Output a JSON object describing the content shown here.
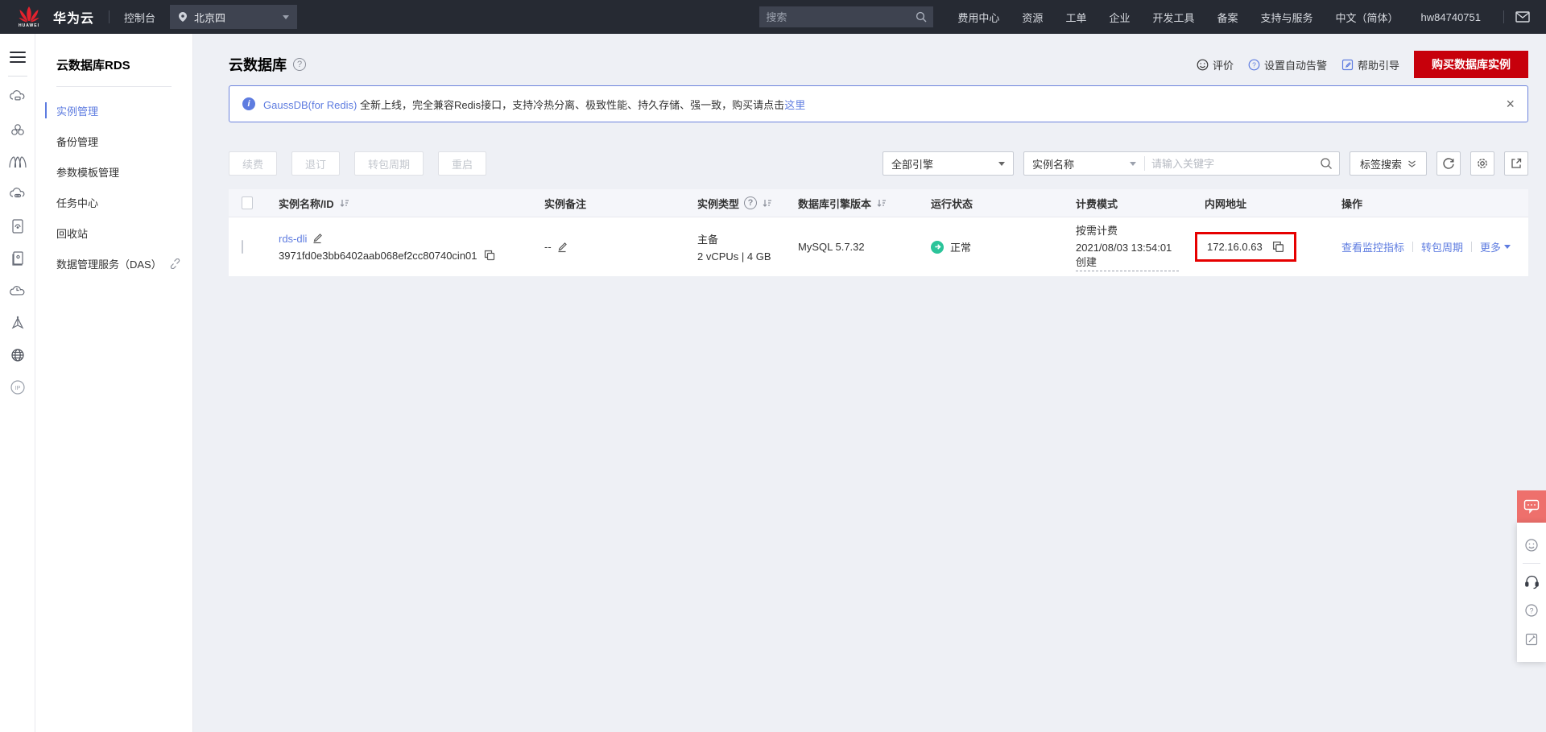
{
  "topbar": {
    "brand": "华为云",
    "logo_text": "HUAWEI",
    "console": "控制台",
    "region": "北京四",
    "search_placeholder": "搜索",
    "menu": [
      "费用中心",
      "资源",
      "工单",
      "企业",
      "开发工具",
      "备案",
      "支持与服务",
      "中文（简体）",
      "hw84740751"
    ]
  },
  "sidebar": {
    "title": "云数据库RDS",
    "items": [
      {
        "label": "实例管理"
      },
      {
        "label": "备份管理"
      },
      {
        "label": "参数模板管理"
      },
      {
        "label": "任务中心"
      },
      {
        "label": "回收站"
      },
      {
        "label": "数据管理服务（DAS）"
      }
    ]
  },
  "header": {
    "title": "云数据库",
    "action_feedback": "评价",
    "action_alarm": "设置自动告警",
    "action_guide": "帮助引导",
    "buy_button": "购买数据库实例"
  },
  "banner": {
    "info_glyph": "i",
    "link": "GaussDB(for Redis)",
    "text": "全新上线，完全兼容Redis接口，支持冷热分离、极致性能、持久存储、强一致，购买请点击",
    "tail_link": "这里",
    "close_glyph": "×"
  },
  "toolbar": {
    "buttons": [
      "续费",
      "退订",
      "转包周期",
      "重启"
    ],
    "engine_filter": "全部引擎",
    "name_filter": "实例名称",
    "keyword_placeholder": "请输入关键字",
    "tag_search": "标签搜索"
  },
  "table": {
    "columns": [
      "实例名称/ID",
      "实例备注",
      "实例类型",
      "数据库引擎版本",
      "运行状态",
      "计费模式",
      "内网地址",
      "操作"
    ],
    "row": {
      "name": "rds-dli",
      "id": "3971fd0e3bb6402aab068ef2cc80740cin01",
      "remark": "--",
      "type_line1": "主备",
      "type_line2": "2 vCPUs | 4 GB",
      "engine": "MySQL 5.7.32",
      "status": "正常",
      "billing_line1": "按需计费",
      "billing_line2": "2021/08/03 13:54:01 创建",
      "ip": "172.16.0.63",
      "action1": "查看监控指标",
      "action2": "转包周期",
      "action3": "更多"
    }
  },
  "colors": {
    "topbar_bg": "#262a33",
    "brand_red": "#c7000b",
    "link_blue": "#5e7ce0",
    "status_green": "#2bc49a",
    "annotation_red": "#e60000",
    "content_bg": "#eef0f5"
  }
}
